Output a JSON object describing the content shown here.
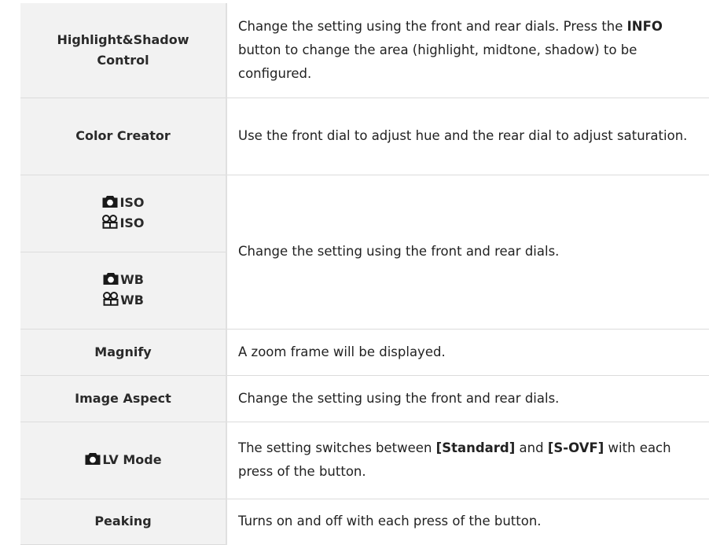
{
  "rows": [
    {
      "name": "Highlight&Shadow Control",
      "desc": {
        "pre": "Change the setting using the front and rear dials. Press the ",
        "bold": "INFO",
        "post": " button to change the area (highlight, midtone, shadow) to be configured."
      }
    },
    {
      "name": "Color Creator",
      "desc": "Use the front dial to adjust hue and the rear dial to adjust saturation."
    },
    {
      "names": [
        "ISO",
        "ISO"
      ],
      "icons": [
        "camera-icon",
        "movie-icon"
      ]
    },
    {
      "names": [
        "WB",
        "WB"
      ],
      "icons": [
        "camera-icon",
        "movie-icon"
      ]
    },
    {
      "shared_desc": "Change the setting using the front and rear dials."
    },
    {
      "name": "Magnify",
      "desc": "A zoom frame will be displayed."
    },
    {
      "name": "Image Aspect",
      "desc": "Change the setting using the front and rear dials."
    },
    {
      "name": "LV Mode",
      "icon": "camera-icon",
      "desc": {
        "pre": "The setting switches between ",
        "bold1": "[Standard]",
        "mid": " and ",
        "bold2": "[S-OVF]",
        "post": " with each press of the button."
      }
    },
    {
      "name": "Peaking",
      "desc": "Turns on and off with each press of the button."
    }
  ]
}
